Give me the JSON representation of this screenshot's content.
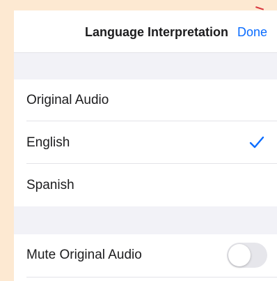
{
  "nav": {
    "title": "Language Interpretation",
    "done_label": "Done"
  },
  "languages": [
    {
      "label": "Original Audio",
      "selected": false
    },
    {
      "label": "English",
      "selected": true
    },
    {
      "label": "Spanish",
      "selected": false
    }
  ],
  "mute": {
    "label": "Mute Original Audio",
    "enabled": false
  },
  "colors": {
    "accent": "#0a6cff",
    "background": "#fde9d2"
  },
  "icons": {
    "selected": "checkmark-icon"
  }
}
